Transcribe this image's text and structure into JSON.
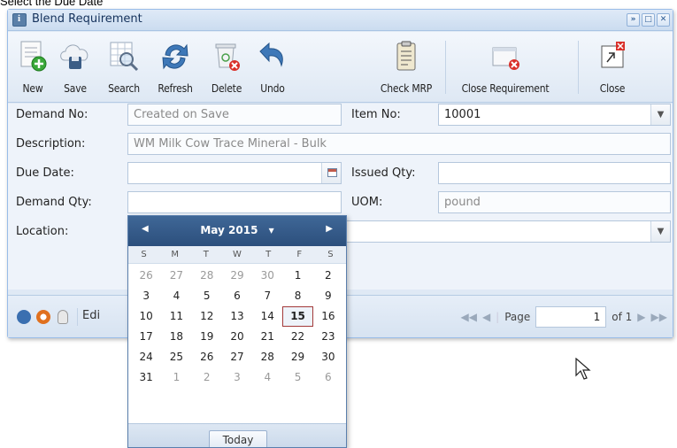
{
  "caption": "Select the Due Date",
  "window": {
    "title": "Blend Requirement",
    "buttons": [
      "»",
      "□",
      "✕"
    ]
  },
  "toolbar": {
    "new": "New",
    "save": "Save",
    "search": "Search",
    "refresh": "Refresh",
    "delete": "Delete",
    "undo": "Undo",
    "check_mrp": "Check MRP",
    "close_requirement": "Close Requirement",
    "close": "Close"
  },
  "form": {
    "demand_no_label": "Demand No:",
    "demand_no_value": "Created on Save",
    "item_no_label": "Item No:",
    "item_no_value": "10001",
    "description_label": "Description:",
    "description_value": "WM Milk Cow Trace Mineral - Bulk",
    "due_date_label": "Due Date:",
    "due_date_value": "",
    "issued_qty_label": "Issued Qty:",
    "issued_qty_value": "",
    "demand_qty_label": "Demand Qty:",
    "uom_label": "UOM:",
    "uom_value": "pound",
    "location_label": "Location:",
    "location_value": ""
  },
  "statusbar": {
    "edit_label": "Edi",
    "page_label": "Page",
    "page_value": "1",
    "of_label": "of 1"
  },
  "datepicker": {
    "month_label": "May 2015",
    "dropdown_glyph": "▾",
    "prev": "◀",
    "next": "▶",
    "weekdays": [
      "S",
      "M",
      "T",
      "W",
      "T",
      "F",
      "S"
    ],
    "weeks": [
      [
        "26",
        "27",
        "28",
        "29",
        "30",
        "1",
        "2"
      ],
      [
        "3",
        "4",
        "5",
        "6",
        "7",
        "8",
        "9"
      ],
      [
        "10",
        "11",
        "12",
        "13",
        "14",
        "15",
        "16"
      ],
      [
        "17",
        "18",
        "19",
        "20",
        "21",
        "22",
        "23"
      ],
      [
        "24",
        "25",
        "26",
        "27",
        "28",
        "29",
        "30"
      ],
      [
        "31",
        "1",
        "2",
        "3",
        "4",
        "5",
        "6"
      ]
    ],
    "selected_day": "15",
    "today_label": "Today"
  }
}
